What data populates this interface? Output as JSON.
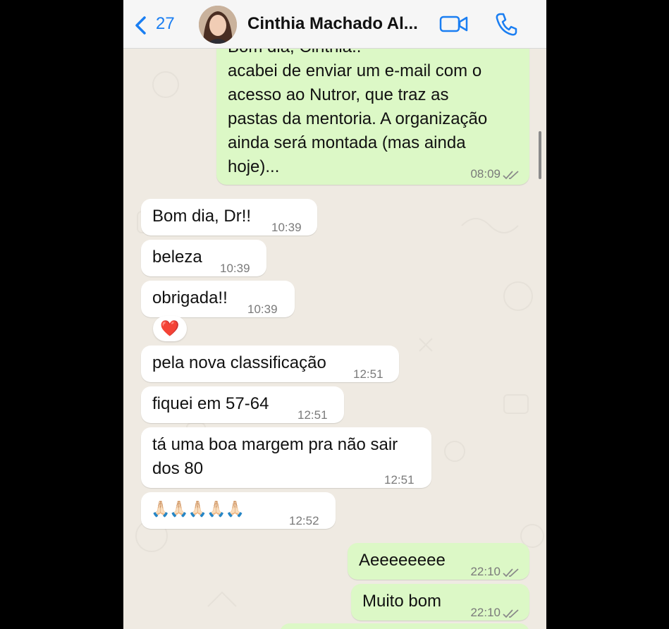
{
  "header": {
    "back_count": "27",
    "contact_name": "Cinthia Machado Al..."
  },
  "colors": {
    "accent": "#1a7ef2",
    "outgoing_bubble": "#dcf8c6",
    "incoming_bubble": "#ffffff",
    "chat_bg": "#efeae2"
  },
  "messages": [
    {
      "dir": "out",
      "lines": [
        "Bom dia, Cinthia..",
        "acabei de enviar um e-mail com o",
        "acesso ao Nutror, que traz as",
        "pastas da mentoria. A organização",
        "ainda será montada (mas ainda",
        "hoje)..."
      ],
      "time": "08:09",
      "read": true
    },
    {
      "dir": "in",
      "text": "Bom dia, Dr!!",
      "time": "10:39"
    },
    {
      "dir": "in",
      "text": "beleza",
      "time": "10:39"
    },
    {
      "dir": "in",
      "text": "obrigada!!",
      "time": "10:39",
      "reaction": "❤️"
    },
    {
      "dir": "in",
      "text": "pela nova classificação",
      "time": "12:51"
    },
    {
      "dir": "in",
      "text": "fiquei em 57-64",
      "time": "12:51"
    },
    {
      "dir": "in",
      "lines": [
        "tá uma boa margem pra não sair",
        "dos 80"
      ],
      "time": "12:51"
    },
    {
      "dir": "in",
      "text": "🙏🏻🙏🏻🙏🏻🙏🏻🙏🏻",
      "time": "12:52"
    },
    {
      "dir": "out",
      "text": "Aeeeeeeee",
      "time": "22:10",
      "read": true
    },
    {
      "dir": "out",
      "text": "Muito bom",
      "time": "22:10",
      "read": true
    }
  ]
}
